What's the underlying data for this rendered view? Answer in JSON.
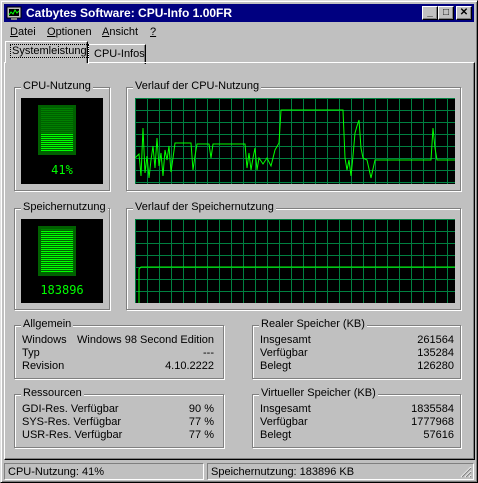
{
  "window": {
    "title": "Catbytes Software: CPU-Info 1.00FR",
    "controls": [
      "_",
      "□",
      "✕"
    ],
    "colors": {
      "titlebar": "#000080",
      "face": "#c0c0c0",
      "graph_bg": "#000000",
      "graph_grid": "#008040",
      "graph_line": "#00ff00"
    }
  },
  "menu": {
    "items": [
      {
        "label_u": "D",
        "label_rest": "atei"
      },
      {
        "label_u": "O",
        "label_rest": "ptionen"
      },
      {
        "label_u": "A",
        "label_rest": "nsicht"
      },
      {
        "label_u": "?",
        "label_rest": ""
      }
    ]
  },
  "tabs": [
    {
      "label": "Systemleistung",
      "active": true
    },
    {
      "label": "CPU-Infos",
      "active": false
    }
  ],
  "cpu": {
    "group_label": "CPU-Nutzung",
    "percent_text": "41%",
    "percent_value": 41,
    "history_label": "Verlauf der CPU-Nutzung"
  },
  "memory": {
    "group_label": "Speichernutzung",
    "value_text": "183896",
    "history_label": "Verlauf der Speichernutzung"
  },
  "general": {
    "label": "Allgemein",
    "rows": [
      {
        "key": "Windows",
        "value": "Windows 98 Second Edition"
      },
      {
        "key": "Typ",
        "value": "---"
      },
      {
        "key": "Revision",
        "value": "4.10.2222"
      }
    ]
  },
  "real_memory": {
    "label": "Realer Speicher (KB)",
    "rows": [
      {
        "key": "Insgesamt",
        "value": "261564"
      },
      {
        "key": "Verfügbar",
        "value": "135284"
      },
      {
        "key": "Belegt",
        "value": "126280"
      }
    ]
  },
  "resources": {
    "label": "Ressourcen",
    "rows": [
      {
        "key": "GDI-Res. Verfügbar",
        "value": "90 %"
      },
      {
        "key": "SYS-Res. Verfügbar",
        "value": "77 %"
      },
      {
        "key": "USR-Res. Verfügbar",
        "value": "77 %"
      }
    ]
  },
  "virtual_memory": {
    "label": "Virtueller Speicher (KB)",
    "rows": [
      {
        "key": "Insgesamt",
        "value": "1835584"
      },
      {
        "key": "Verfügbar",
        "value": "1777968"
      },
      {
        "key": "Belegt",
        "value": "57616"
      }
    ]
  },
  "status": {
    "cpu": "CPU-Nutzung: 41%",
    "memory": "Speichernutzung: 183896 KB"
  }
}
